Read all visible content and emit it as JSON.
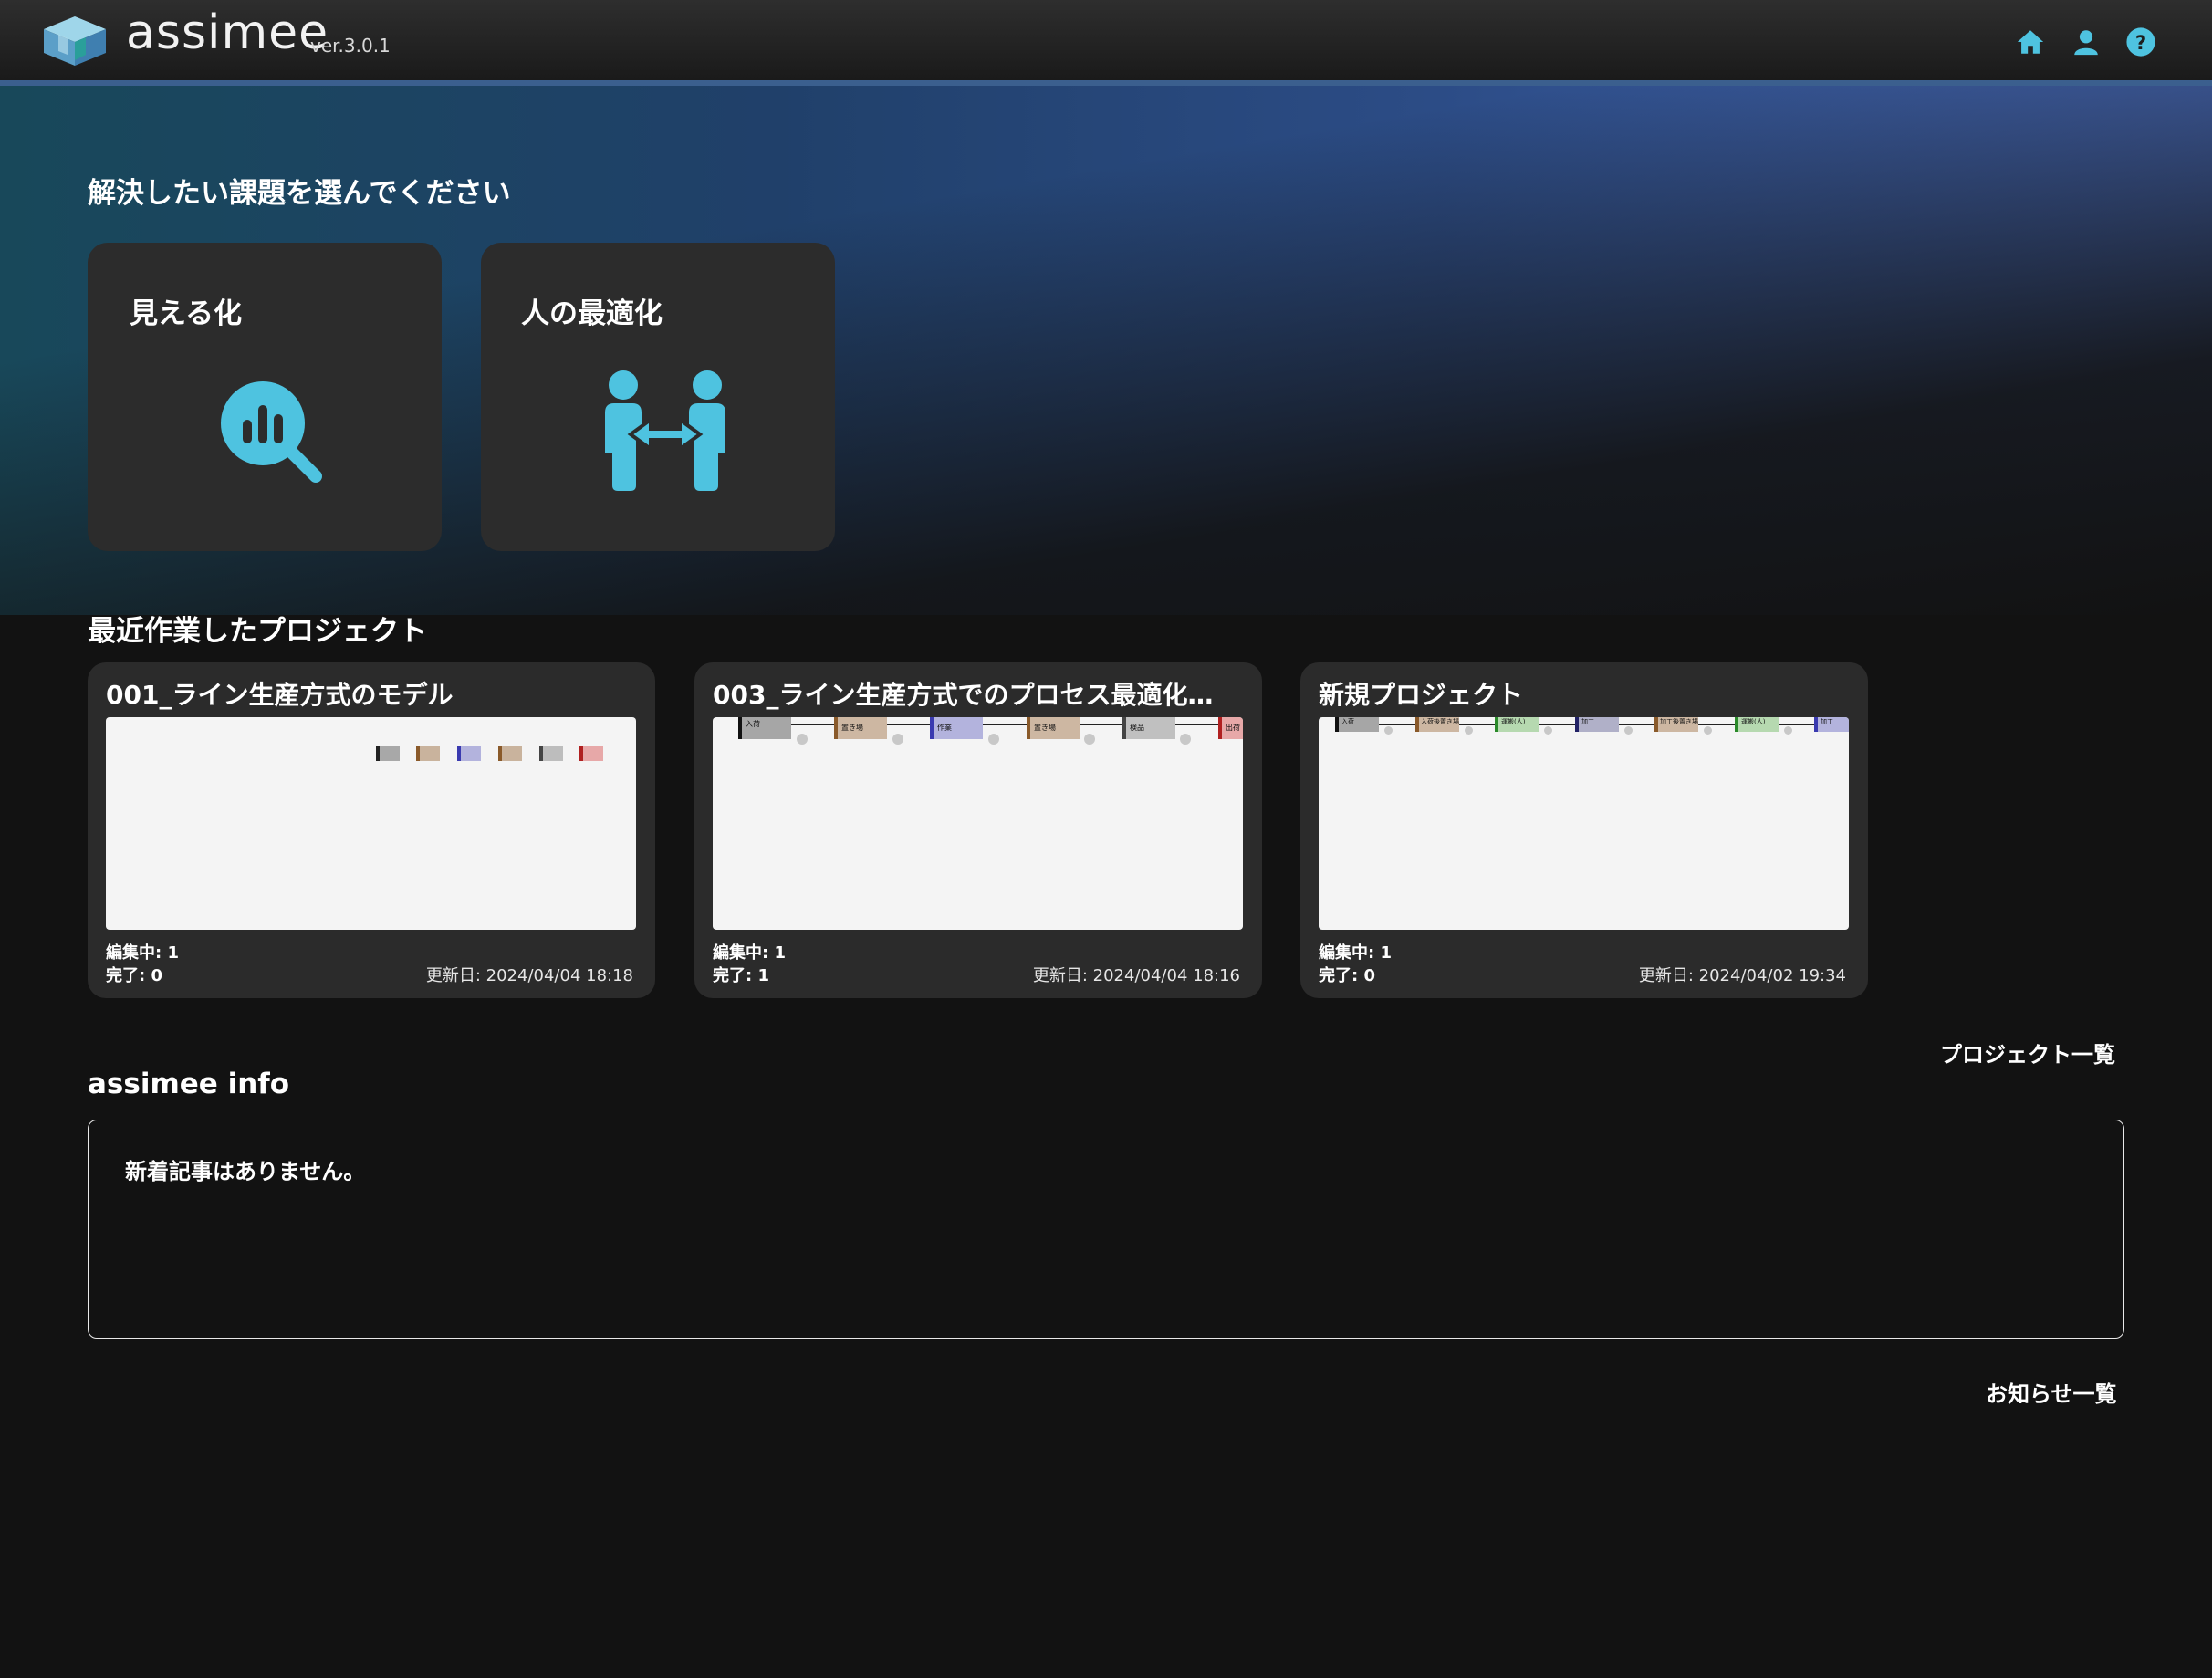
{
  "header": {
    "brand": "assimee",
    "version": "ver.3.0.1",
    "nav": [
      {
        "icon": "home-icon"
      },
      {
        "icon": "user-icon"
      },
      {
        "icon": "help-icon"
      }
    ],
    "accent_color": "#4ec3e0"
  },
  "solutions": {
    "title": "解決したい課題を選んでください",
    "tiles": [
      {
        "label": "見える化",
        "icon": "magnify-chart-icon"
      },
      {
        "label": "人の最適化",
        "icon": "people-exchange-icon"
      }
    ]
  },
  "recent": {
    "title": "最近作業したプロジェクト",
    "projects": [
      {
        "name": "001_ライン生産方式のモデル",
        "editing": "編集中: 1",
        "done": "完了: 0",
        "updated": "更新日: 2024/04/04 18:18"
      },
      {
        "name": "003_ライン生産方式でのプロセス最適化…",
        "editing": "編集中: 1",
        "done": "完了: 1",
        "updated": "更新日: 2024/04/04 18:16"
      },
      {
        "name": "新規プロジェクト",
        "editing": "編集中: 1",
        "done": "完了: 0",
        "updated": "更新日: 2024/04/02 19:34"
      }
    ],
    "thumbnail_labels": {
      "p2": [
        "入荷",
        "置き場",
        "作業",
        "置き場",
        "検品",
        "出荷"
      ],
      "p3": [
        "入荷",
        "入荷後置き場",
        "運搬(人)",
        "加工",
        "加工後置き場",
        "運搬(人)",
        "加工"
      ]
    },
    "all_link": "プロジェクト一覧"
  },
  "info": {
    "title": "assimee info",
    "message": "新着記事はありません。",
    "all_link": "お知らせ一覧"
  }
}
